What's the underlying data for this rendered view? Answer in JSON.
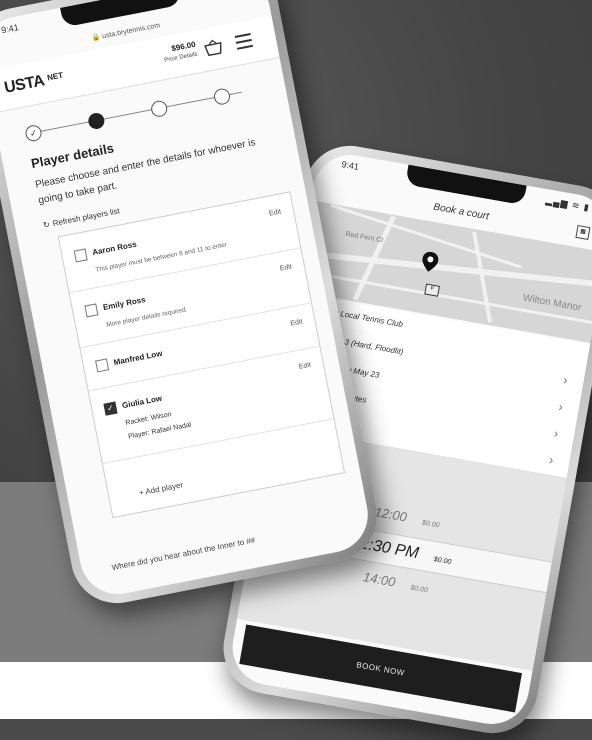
{
  "colors": {
    "background_top": "#4b4b4b",
    "background_band": "#7b7b7b",
    "accent_dark": "#1e1e1e"
  },
  "phone1": {
    "status": {
      "time": "9:41",
      "icons": "▂▄▆ ≋ ▮"
    },
    "url": "🔒 usta.brytennis.com",
    "header": {
      "logo": "USTA",
      "logo_tag": "NET",
      "cart_total": "$96.00",
      "cart_sub": "Price Details",
      "cart_icon": "basket-icon",
      "menu_icon": "hamburger-menu-icon"
    },
    "stepper": {
      "steps": [
        {
          "state": "done",
          "label": "✓"
        },
        {
          "state": "current",
          "label": ""
        },
        {
          "state": "upcoming",
          "label": ""
        },
        {
          "state": "upcoming",
          "label": ""
        }
      ]
    },
    "title": "Player details",
    "description": "Please choose and enter the details for whoever is going to take part.",
    "refresh": "Refresh players list",
    "players": [
      {
        "name": "Aaron Ross",
        "note": "This player must be between 8 and 11 to enter",
        "edit": "Edit",
        "checked": false
      },
      {
        "name": "Emily Ross",
        "note": "More player details required.",
        "edit": "Edit",
        "checked": false
      },
      {
        "name": "Manfred Low",
        "note": "",
        "edit": "Edit",
        "checked": false
      },
      {
        "name": "Giulia Low",
        "note": "",
        "edit": "Edit",
        "checked": true,
        "details": [
          "Racket: Wilson",
          "Player: Rafael Nadal"
        ]
      }
    ],
    "add_player": "+ Add player",
    "bottom_text": "Where did you hear about the Inner to ##"
  },
  "phone2": {
    "status": {
      "time": "9:41",
      "icons": "▂▄▆ ≋ ▮"
    },
    "title": "Book a court",
    "map": {
      "labels": [
        "Red Fern Ct",
        "Wilton Manor"
      ]
    },
    "rows": [
      {
        "icon": "location-icon",
        "text": "My Local Tennis Club",
        "chevron": ""
      },
      {
        "icon": "court-icon",
        "text": "Court 3 (Hard, Floodlit)",
        "chevron": "›"
      },
      {
        "icon": "calendar-icon",
        "text": "Thursday May 23",
        "chevron": "›"
      },
      {
        "icon": "clock-icon",
        "text": "For 60 minutes",
        "chevron": "›"
      },
      {
        "icon": "",
        "text": "",
        "chevron": "›"
      }
    ],
    "slots": [
      {
        "time": "12:00",
        "price": "$0.00",
        "selected": false
      },
      {
        "time": "12:30 PM",
        "price": "$0.00",
        "selected": true
      },
      {
        "time": "14:00",
        "price": "$0.00",
        "selected": false
      }
    ],
    "book_button": "BOOK NOW"
  }
}
